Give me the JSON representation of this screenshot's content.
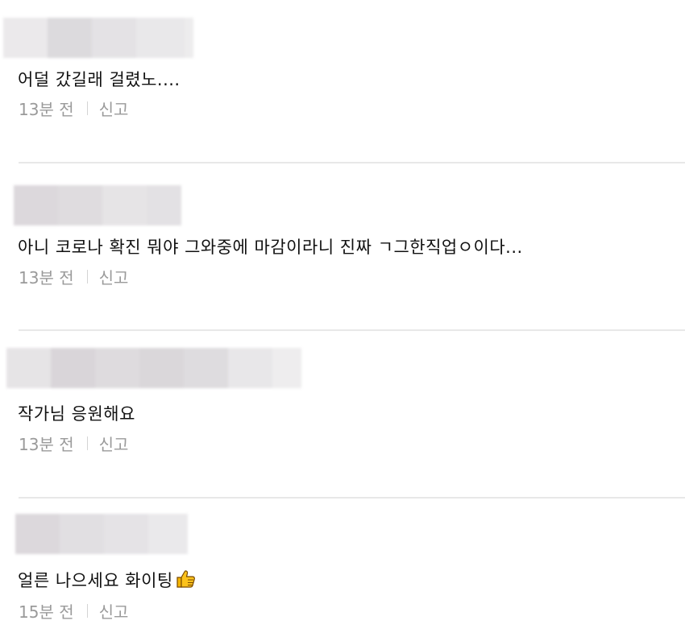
{
  "comments": [
    {
      "text": "어덜 갔길래 걸렸노....",
      "time": "13분 전",
      "report_label": "신고"
    },
    {
      "text": "아니 코로나 확진 뭐야 그와중에 마감이라니 진짜 ㄱ그한직업ㅇ이다...",
      "time": "13분 전",
      "report_label": "신고"
    },
    {
      "text": "작가님 응원해요",
      "time": "13분 전",
      "report_label": "신고"
    },
    {
      "text": "얼른 나으세요 화이팅",
      "time": "15분 전",
      "report_label": "신고",
      "emoji": "thumbs-up-icon"
    }
  ],
  "colors": {
    "text": "#111111",
    "meta": "#9a9a9a",
    "divider": "#e8e8e8",
    "blur": "#e3e1e4"
  }
}
